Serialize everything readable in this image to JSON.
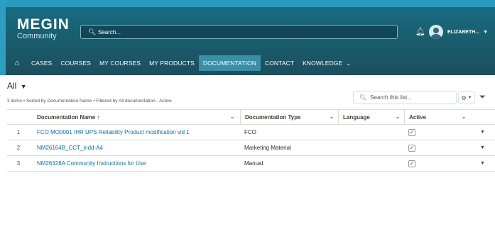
{
  "brand": {
    "line1": "MEGIN",
    "line2": "Community"
  },
  "header": {
    "search_placeholder": "Search...",
    "user_name": "ELIZABETH...",
    "user_caret": "▼"
  },
  "nav": {
    "items": [
      {
        "label": "CASES"
      },
      {
        "label": "COURSES"
      },
      {
        "label": "MY COURSES"
      },
      {
        "label": "MY PRODUCTS"
      },
      {
        "label": "DOCUMENTATION"
      },
      {
        "label": "CONTACT"
      },
      {
        "label": "KNOWLEDGE"
      }
    ],
    "active": "DOCUMENTATION"
  },
  "list": {
    "view_name": "All",
    "meta": "3 items • Sorted by Documentation Name • Filtered by All documentation - Active",
    "search_placeholder": "Search this list...",
    "columns": {
      "name": "Documentation Name",
      "sort_indicator": "↑",
      "type": "Documentation Type",
      "language": "Language",
      "active": "Active"
    },
    "rows": [
      {
        "num": "1",
        "name": "FCO MO0001 IHR UPS Reliability Product modification vid 1",
        "type": "FCO",
        "language": "",
        "active": true
      },
      {
        "num": "2",
        "name": "NM26164B_CCT_indd-A4",
        "type": "Marketing Material",
        "language": "",
        "active": true
      },
      {
        "num": "3",
        "name": "NM26328A Community Instructions for Use",
        "type": "Manual",
        "language": "",
        "active": true
      }
    ]
  },
  "icons": {
    "home": "home-icon",
    "search": "search-icon",
    "bell": "bell-icon",
    "gear": "gear-icon",
    "filter": "filter-icon"
  },
  "colors": {
    "header_top": "#1a6e86",
    "header_bottom": "#1d4e5f",
    "frame": "#2d9ec2",
    "nav_active": "#3a8fa6",
    "link": "#0e6fa6"
  }
}
